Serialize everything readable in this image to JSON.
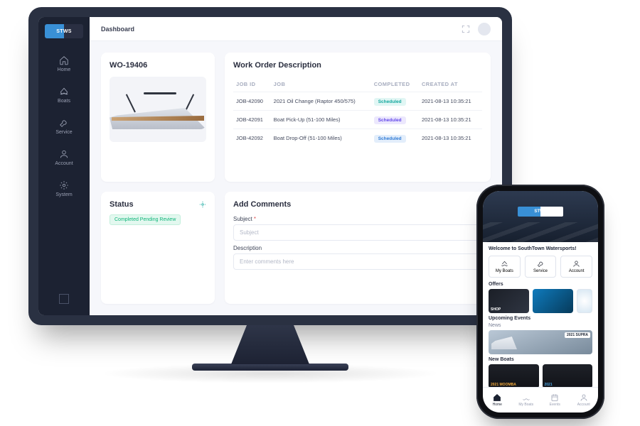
{
  "desktop": {
    "logo": "STWS",
    "topbar": {
      "title": "Dashboard"
    },
    "sidebar": {
      "items": [
        {
          "label": "Home"
        },
        {
          "label": "Boats"
        },
        {
          "label": "Service"
        },
        {
          "label": "Account"
        },
        {
          "label": "System"
        }
      ]
    },
    "work_order": {
      "id": "WO-19406"
    },
    "wod": {
      "title": "Work Order Description",
      "headers": {
        "job_id": "JOB ID",
        "job": "JOB",
        "completed": "COMPLETED",
        "created": "CREATED AT"
      },
      "rows": [
        {
          "job_id": "JOB-42090",
          "job": "2021 Oil Change (Raptor 450/575)",
          "status": "Scheduled",
          "status_class": "s-teal",
          "created": "2021-08-13 10:35:21"
        },
        {
          "job_id": "JOB-42091",
          "job": "Boat Pick-Up (51-100 Miles)",
          "status": "Scheduled",
          "status_class": "s-purple",
          "created": "2021-08-13 10:35:21"
        },
        {
          "job_id": "JOB-42092",
          "job": "Boat Drop-Off (51-100 Miles)",
          "status": "Scheduled",
          "status_class": "s-blue",
          "created": "2021-08-13 10:35:21"
        }
      ]
    },
    "status": {
      "title": "Status",
      "badge": "Completed Pending Review"
    },
    "comments": {
      "title": "Add Comments",
      "subject_label": "Subject",
      "subject_required": "*",
      "subject_placeholder": "Subject",
      "desc_label": "Description",
      "desc_placeholder": "Enter comments here"
    }
  },
  "mobile": {
    "logo": "STWS",
    "welcome": "Welcome to SouthTown Watersports!",
    "buttons": [
      {
        "label": "My Boats"
      },
      {
        "label": "Service"
      },
      {
        "label": "Account"
      }
    ],
    "sections": {
      "offers": "Offers",
      "events": "Upcoming Events",
      "news": "News",
      "newboats": "New Boats"
    },
    "offers": [
      {
        "label": "SHOP"
      },
      {
        "label": ""
      },
      {
        "label": ""
      }
    ],
    "event_year": "2021 SUPRA",
    "newboats": [
      {
        "label": "2021 MOOMBA"
      },
      {
        "label": "2021"
      }
    ],
    "tabs": [
      {
        "label": "Home"
      },
      {
        "label": "My Boats"
      },
      {
        "label": "Events"
      },
      {
        "label": "Account"
      }
    ]
  }
}
